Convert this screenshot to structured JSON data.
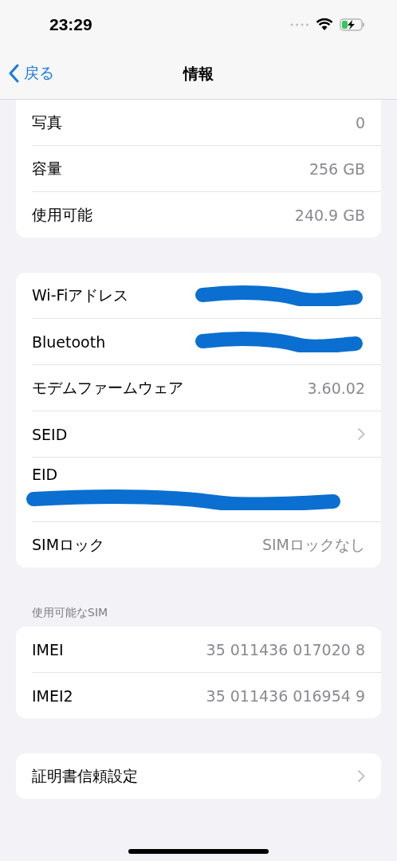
{
  "status_bar": {
    "time": "23:29",
    "charging": true
  },
  "nav": {
    "back": "戻る",
    "title": "情報"
  },
  "groups": [
    {
      "rows": [
        {
          "kind": "value",
          "label": "写真",
          "value": "0"
        },
        {
          "kind": "value",
          "label": "容量",
          "value": "256 GB"
        },
        {
          "kind": "value",
          "label": "使用可能",
          "value": "240.9 GB"
        }
      ]
    },
    {
      "rows": [
        {
          "kind": "redacted",
          "label": "Wi-Fiアドレス"
        },
        {
          "kind": "redacted",
          "label": "Bluetooth"
        },
        {
          "kind": "value",
          "label": "モデムファームウェア",
          "value": "3.60.02"
        },
        {
          "kind": "link",
          "label": "SEID"
        },
        {
          "kind": "redacted-below",
          "label": "EID"
        },
        {
          "kind": "value",
          "label": "SIMロック",
          "value": "SIMロックなし"
        }
      ]
    },
    {
      "header": "使用可能なSIM",
      "rows": [
        {
          "kind": "value",
          "label": "IMEI",
          "value": "35 011436 017020 8"
        },
        {
          "kind": "value",
          "label": "IMEI2",
          "value": "35 011436 016954 9"
        }
      ]
    },
    {
      "rows": [
        {
          "kind": "link",
          "label": "証明書信頼設定"
        }
      ]
    }
  ]
}
